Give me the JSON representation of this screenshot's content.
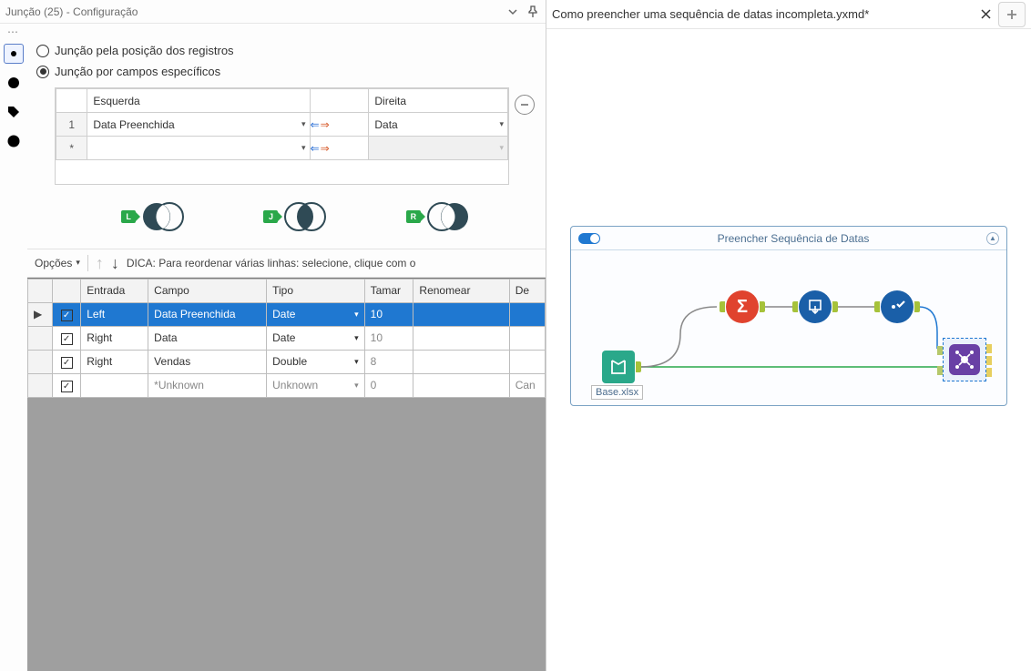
{
  "config_panel": {
    "title": "Junção (25) - Configuração",
    "radio_position": "Junção pela posição dos registros",
    "radio_fields": "Junção por campos específicos",
    "fields_table": {
      "left_header": "Esquerda",
      "right_header": "Direita",
      "rows": [
        {
          "rownum": "1",
          "left": "Data Preenchida",
          "right": "Data"
        },
        {
          "rownum": "*",
          "left": "",
          "right": ""
        }
      ]
    },
    "venn": {
      "L": "L",
      "J": "J",
      "R": "R"
    },
    "options_label": "Opções",
    "hint": "DICA: Para reordenar várias linhas: selecione, clique com o",
    "grid": {
      "headers": {
        "entrada": "Entrada",
        "campo": "Campo",
        "tipo": "Tipo",
        "tamanho": "Tamar",
        "renomear": "Renomear",
        "de": "De"
      },
      "rows": [
        {
          "sel": true,
          "checked": true,
          "entrada": "Left",
          "campo": "Data Preenchida",
          "tipo": "Date",
          "tam": "10",
          "ren": "",
          "de": ""
        },
        {
          "sel": false,
          "checked": true,
          "entrada": "Right",
          "campo": "Data",
          "tipo": "Date",
          "tam": "10",
          "ren": "",
          "de": ""
        },
        {
          "sel": false,
          "checked": true,
          "entrada": "Right",
          "campo": "Vendas",
          "tipo": "Double",
          "tam": "8",
          "ren": "",
          "de": ""
        },
        {
          "sel": false,
          "checked": true,
          "entrada": "",
          "campo": "*Unknown",
          "tipo": "Unknown",
          "tam": "0",
          "ren": "",
          "de": "Can",
          "muted": true
        }
      ]
    }
  },
  "workflow": {
    "tab_title": "Como preencher uma sequência de datas incompleta.yxmd*",
    "container_title": "Preencher Sequência de Datas",
    "input_file": "Base.xlsx"
  }
}
